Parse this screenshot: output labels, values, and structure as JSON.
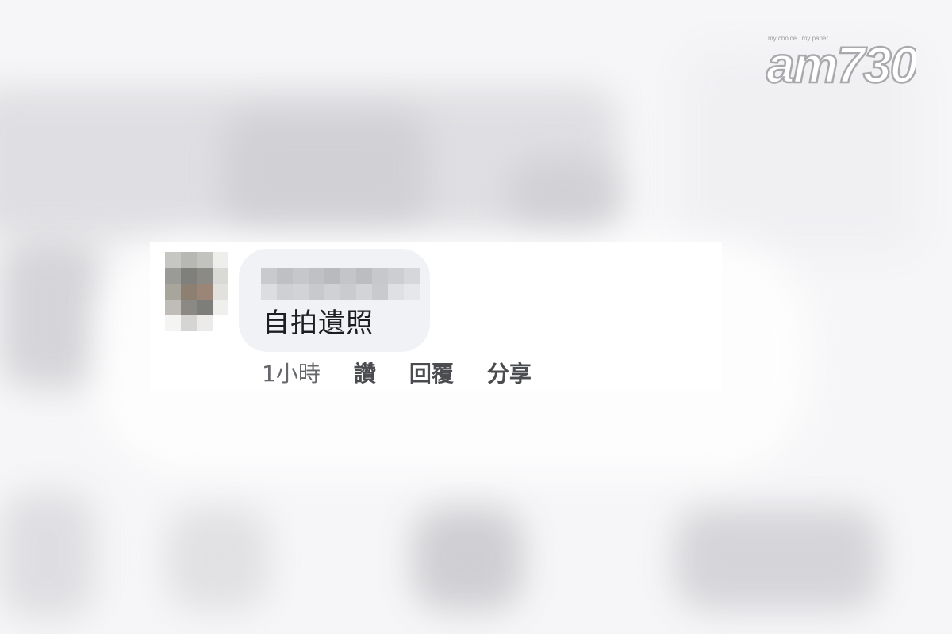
{
  "logo": {
    "tagline": "my choice . my paper",
    "brand": "am730"
  },
  "comment": {
    "author_name": "",
    "text": "自拍遺照",
    "timestamp": "1小時",
    "actions": {
      "like": "讚",
      "reply": "回覆",
      "share": "分享"
    }
  }
}
